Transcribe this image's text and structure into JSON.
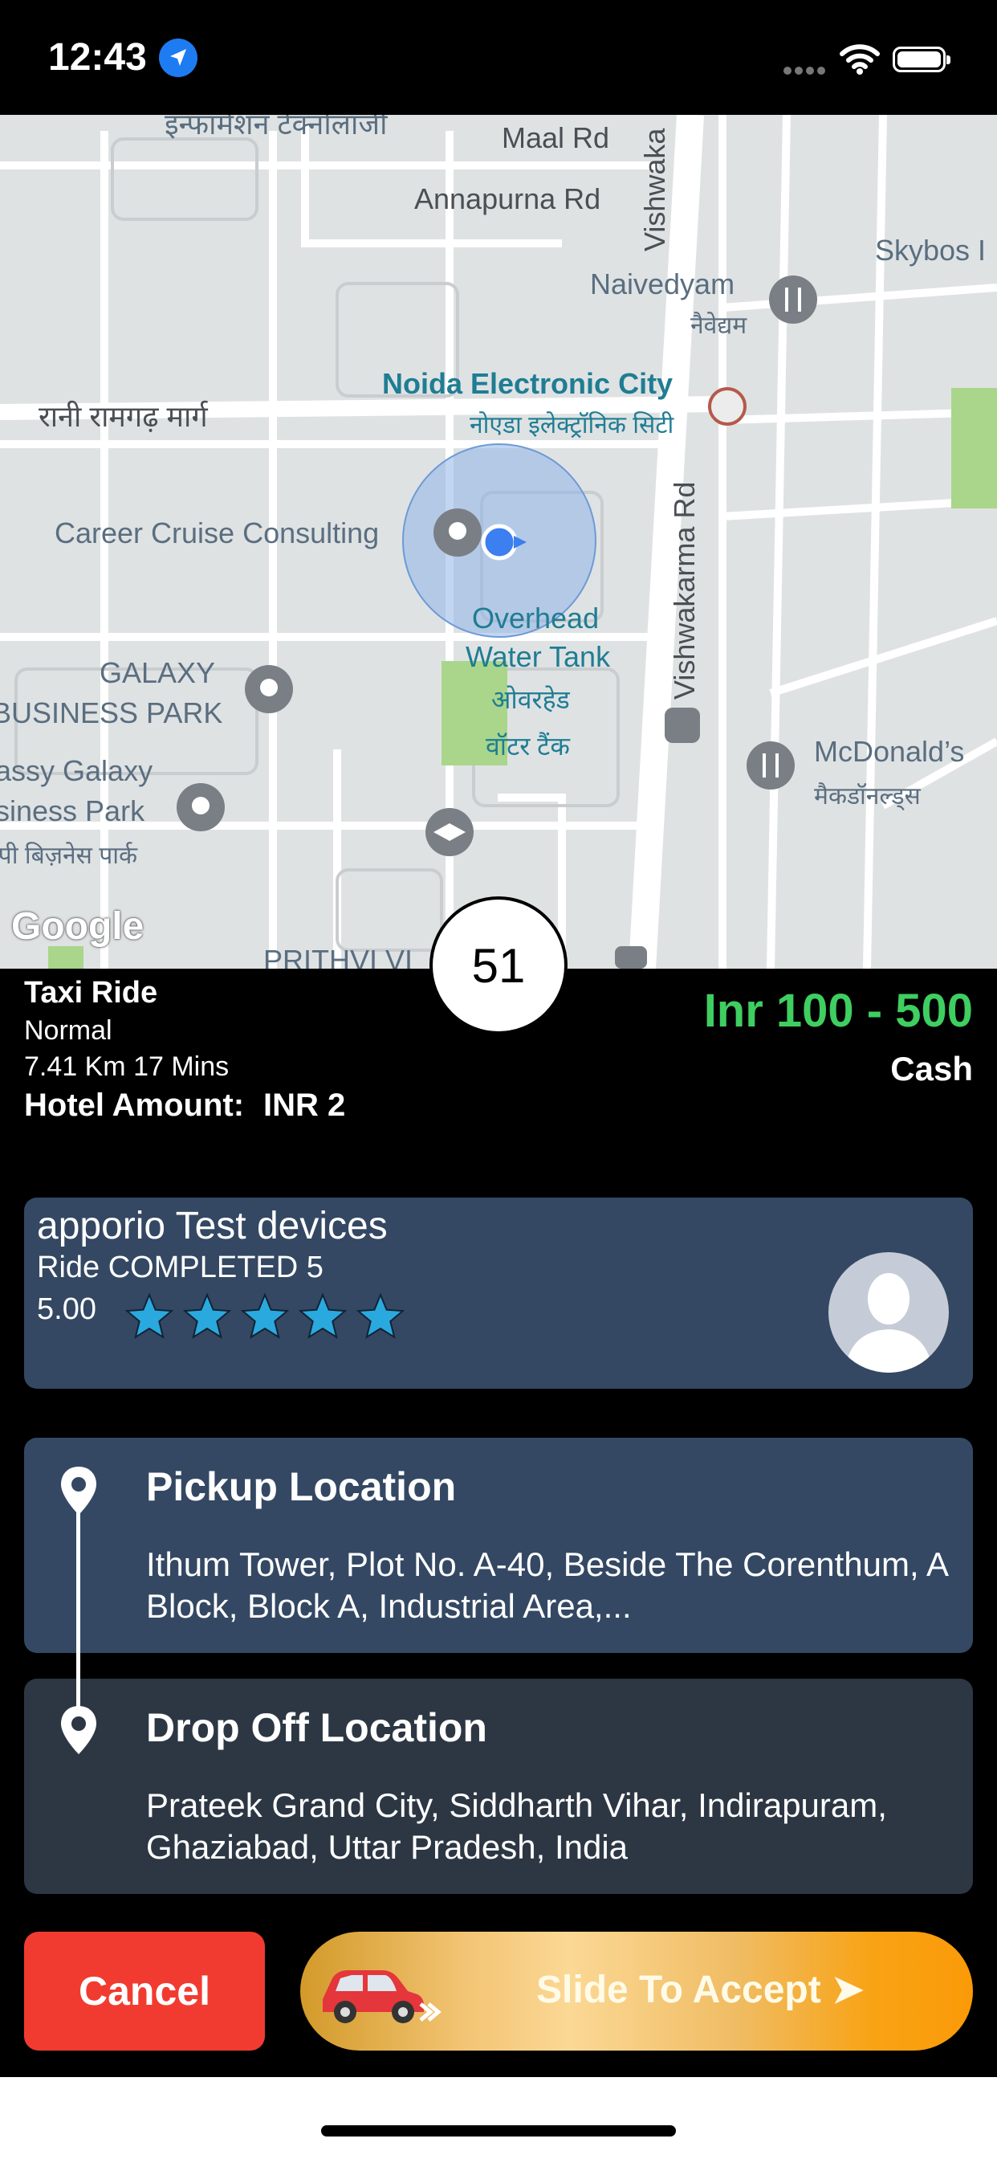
{
  "status_bar": {
    "time": "12:43",
    "location_icon": "location-arrow-icon",
    "signal_icon": "signal-dots-icon",
    "wifi_icon": "wifi-icon",
    "battery_icon": "battery-icon"
  },
  "map": {
    "labels": {
      "top_partial": "इन्फॉर्मेशन टेक्नोलॉजी",
      "maal_rd": "Maal Rd",
      "annapurna_rd": "Annapurna Rd",
      "vishwakarma_top": "Vishwaka",
      "naivedyam": "Naivedyam",
      "naivedyam_hi": "नैवेद्यम",
      "skybos": "Skybos I",
      "noida_ec": "Noida Electronic City",
      "noida_ec_hi": "नोएडा इलेक्ट्रॉनिक सिटी",
      "rani_ramgarh": "रानी रामगढ़ मार्ग",
      "career_cruise": "Career Cruise Consulting",
      "overhead": "Overhead",
      "water_tank": "Water Tank",
      "overhead_hi": "ओवरहेड",
      "water_tank_hi": "वॉटर टैंक",
      "vishwakarma_rd": "Vishwakarma Rd",
      "galaxy": "GALAXY",
      "business_park": "BUSINESS PARK",
      "classy_galaxy": "assy Galaxy",
      "siness_park": "siness Park",
      "siness_park_hi": "स्पी बिज़नेस पार्क",
      "mcdonalds": "McDonald’s",
      "mcdonalds_hi": "मैकडॉनल्ड्स",
      "prithvi": "PRITHVI VI"
    },
    "google_logo": "Google"
  },
  "timer": {
    "value": "51"
  },
  "ride": {
    "type": "Taxi Ride",
    "class": "Normal",
    "distance_time": "7.41 Km 17 Mins",
    "hotel_label": "Hotel Amount:",
    "hotel_value": "INR 2",
    "fare": "Inr 100 - 500",
    "payment": "Cash"
  },
  "driver": {
    "name": "apporio Test devices",
    "rides_completed": "Ride COMPLETED 5",
    "rating": "5.00",
    "stars": 5
  },
  "pickup": {
    "title": "Pickup Location",
    "address": "Ithum Tower, Plot No. A-40, Beside The Corenthum, A Block, Block A, Industrial Area,..."
  },
  "drop": {
    "title": "Drop Off Location",
    "address": "Prateek Grand City, Siddharth Vihar, Indirapuram, Ghaziabad, Uttar Pradesh, India"
  },
  "actions": {
    "cancel_label": "Cancel",
    "slide_label": "Slide To Accept ➤"
  },
  "colors": {
    "fare_green": "#3fce60",
    "card_blue": "#344863",
    "card_dark": "#2d3744",
    "cancel_red": "#f23b30",
    "slider_orange": "#fb9a08"
  }
}
